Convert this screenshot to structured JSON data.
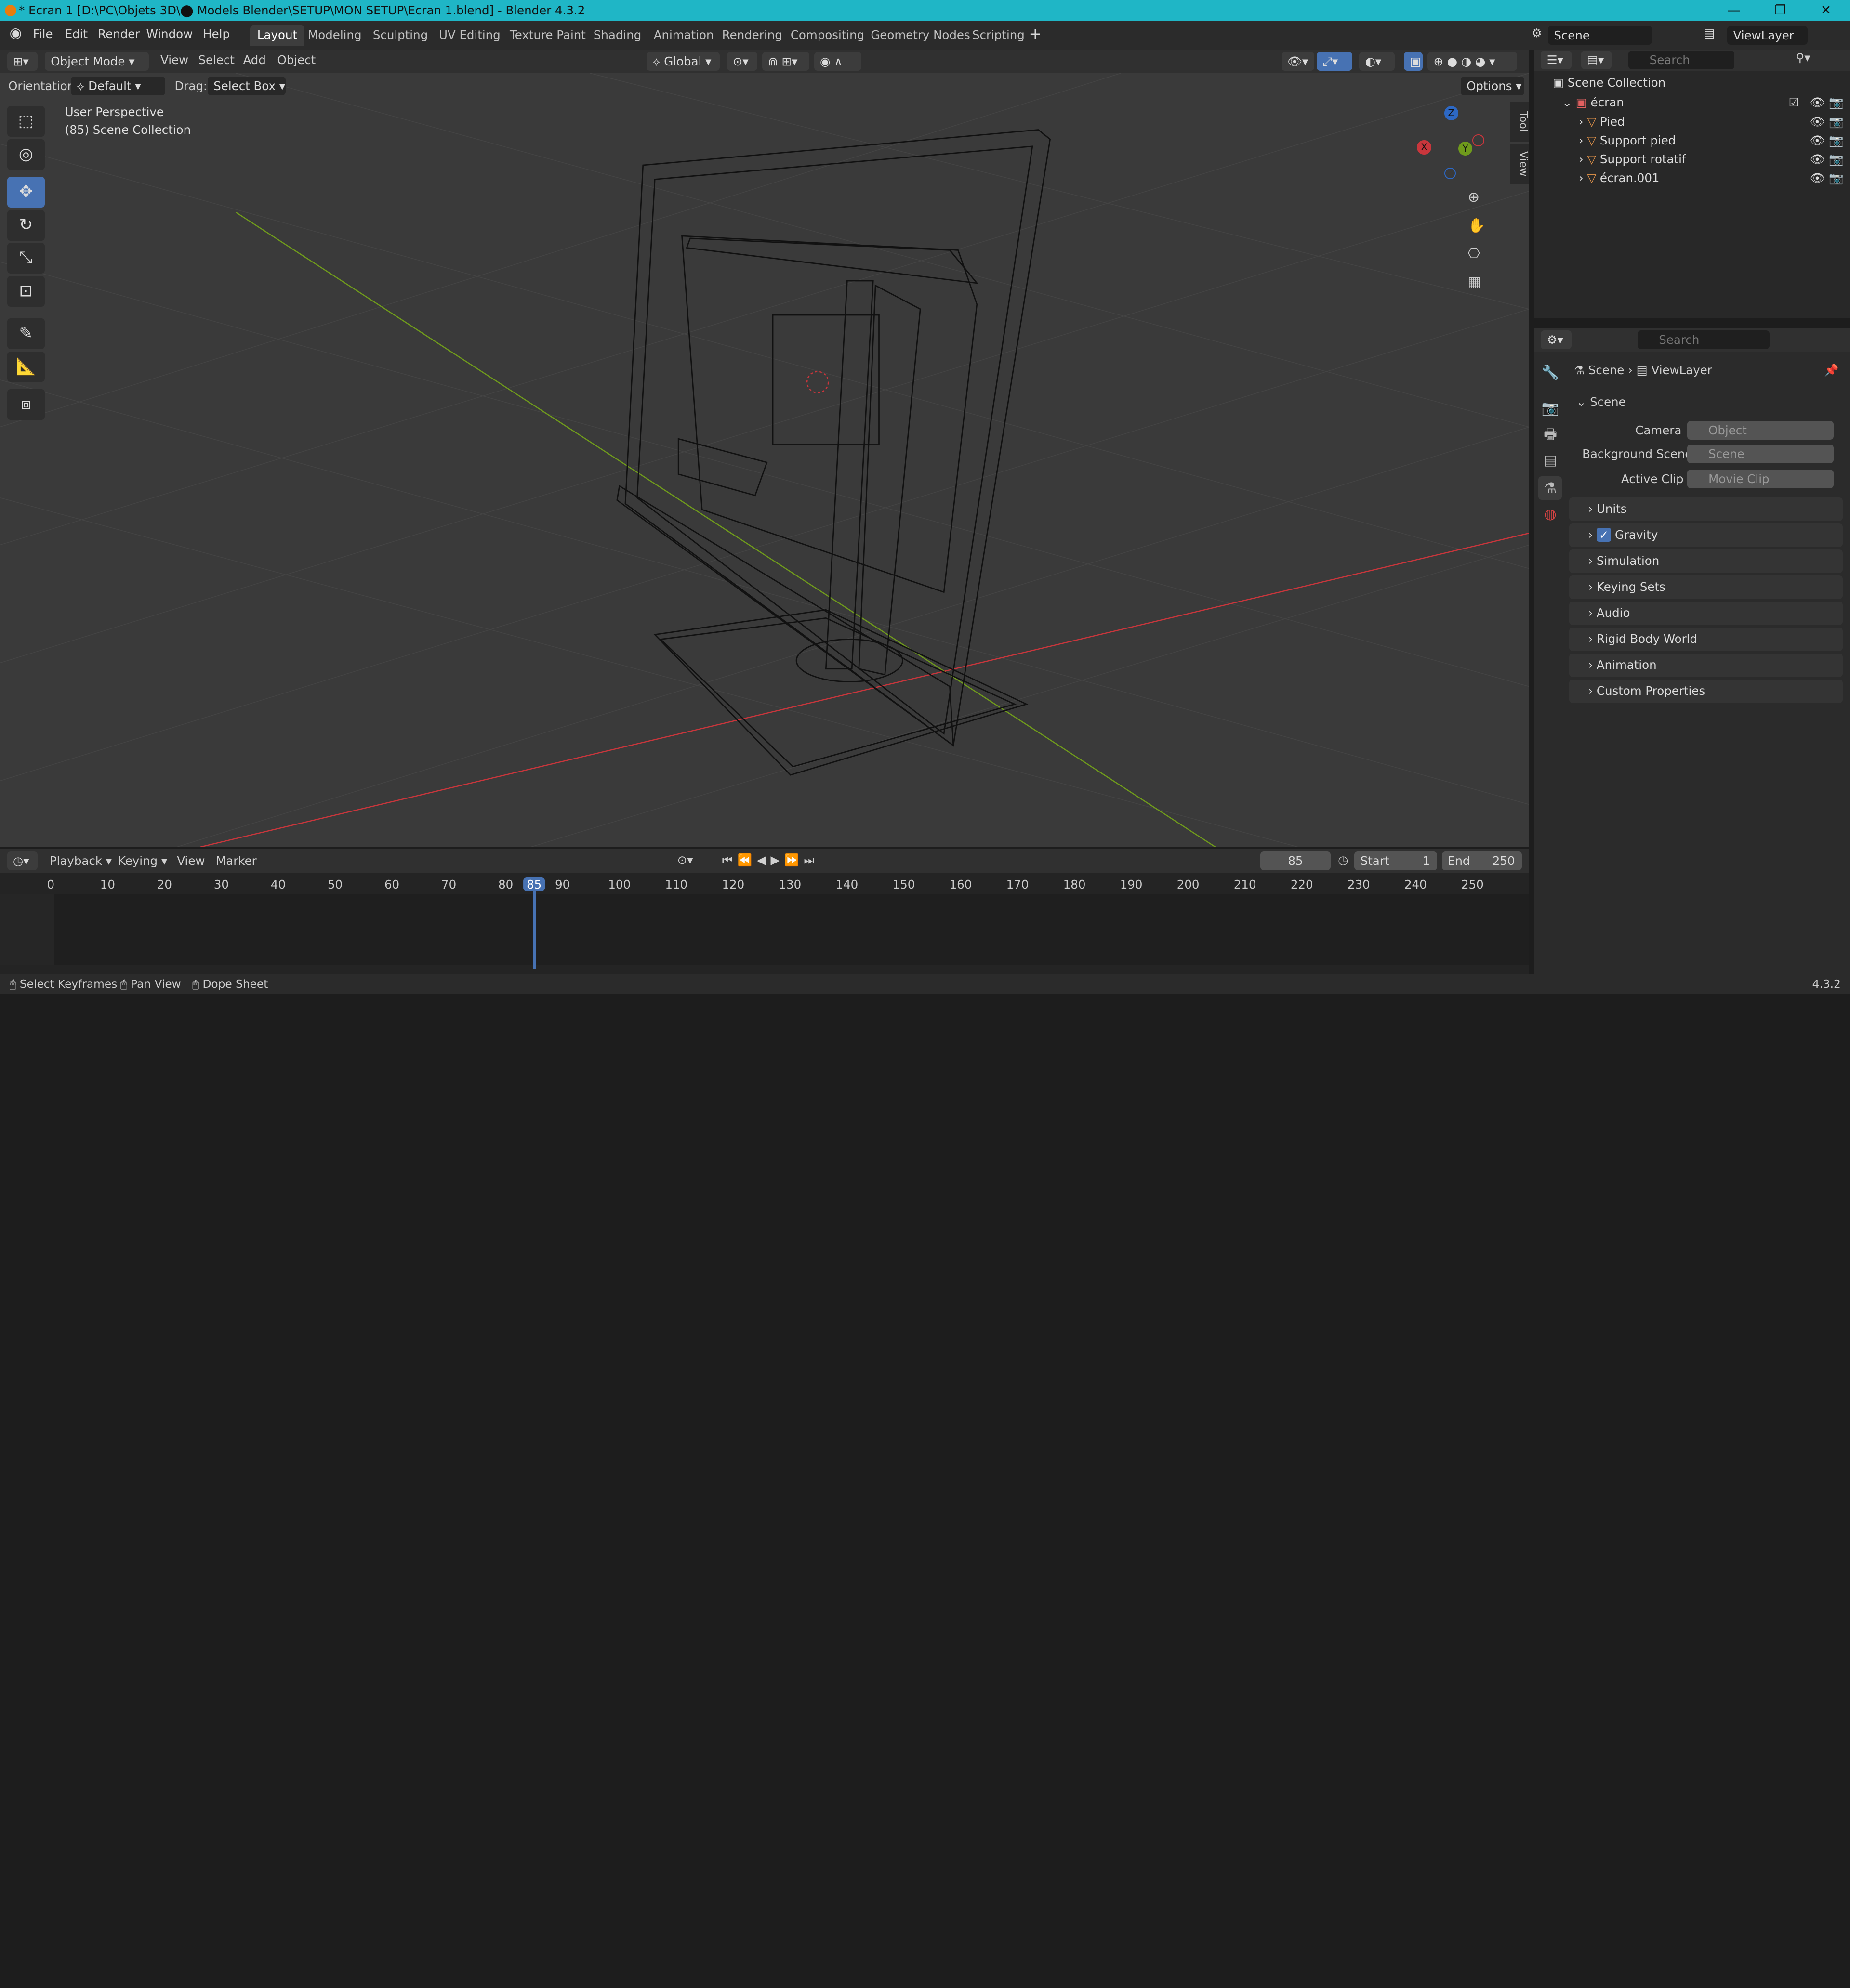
{
  "titlebar": {
    "title": "* Ecran 1 [D:\\PC\\Objets 3D\\⬤ Models Blender\\SETUP\\MON SETUP\\Ecran 1.blend] - Blender 4.3.2"
  },
  "menu": {
    "file": "File",
    "edit": "Edit",
    "render": "Render",
    "window": "Window",
    "help": "Help"
  },
  "workspaces": [
    "Layout",
    "Modeling",
    "Sculpting",
    "UV Editing",
    "Texture Paint",
    "Shading",
    "Animation",
    "Rendering",
    "Compositing",
    "Geometry Nodes",
    "Scripting"
  ],
  "top_right": {
    "scene": "Scene",
    "viewlayer": "ViewLayer"
  },
  "viewport_header": {
    "mode": "Object Mode",
    "view": "View",
    "select": "Select",
    "add": "Add",
    "object": "Object",
    "transform": "Global",
    "orientation_label": "Orientation:",
    "orientation": "Default",
    "drag_label": "Drag:",
    "drag": "Select Box",
    "options": "Options"
  },
  "viewport": {
    "perspective": "User Perspective",
    "collection": "(85) Scene Collection",
    "tab_tool": "Tool",
    "tab_view": "View",
    "gizmo": {
      "z": "Z",
      "y": "Y",
      "x": "X"
    }
  },
  "outliner": {
    "search_placeholder": "Search",
    "root": "Scene Collection",
    "collection": "écran",
    "items": [
      "Pied",
      "Support pied",
      "Support rotatif",
      "écran.001"
    ]
  },
  "properties": {
    "search_placeholder": "Search",
    "breadcrumb_scene": "Scene",
    "breadcrumb_layer": "ViewLayer",
    "section": "Scene",
    "camera_label": "Camera",
    "camera_value": "Object",
    "bg_label": "Background Scene",
    "bg_value": "Scene",
    "clip_label": "Active Clip",
    "clip_value": "Movie Clip",
    "panels": [
      "Units",
      "Gravity",
      "Simulation",
      "Keying Sets",
      "Audio",
      "Rigid Body World",
      "Animation",
      "Custom Properties"
    ]
  },
  "timeline": {
    "playback": "Playback",
    "keying": "Keying",
    "view": "View",
    "marker": "Marker",
    "current_frame": "85",
    "start_label": "Start",
    "start": "1",
    "end_label": "End",
    "end": "250",
    "ticks": [
      "0",
      "10",
      "20",
      "30",
      "40",
      "50",
      "60",
      "70",
      "80",
      "85",
      "90",
      "100",
      "110",
      "120",
      "130",
      "140",
      "150",
      "160",
      "170",
      "180",
      "190",
      "200",
      "210",
      "220",
      "230",
      "240",
      "250"
    ]
  },
  "status": {
    "select": "Select Keyframes",
    "pan": "Pan View",
    "dope": "Dope Sheet",
    "version": "4.3.2"
  },
  "colors": {
    "accent": "#4772b3",
    "title": "#1fb6c6",
    "x_axis": "#c9363c",
    "y_axis": "#6f9a1c",
    "z_axis": "#2d68c4"
  }
}
